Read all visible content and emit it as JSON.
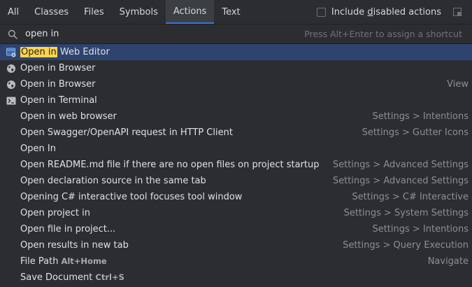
{
  "tabs": [
    {
      "label": "All",
      "active": false
    },
    {
      "label": "Classes",
      "active": false
    },
    {
      "label": "Files",
      "active": false
    },
    {
      "label": "Symbols",
      "active": false
    },
    {
      "label": "Actions",
      "active": true
    },
    {
      "label": "Text",
      "active": false
    }
  ],
  "options": {
    "include_disabled_prefix": "Include ",
    "include_disabled_mnemonic": "d",
    "include_disabled_suffix": "isabled actions",
    "include_disabled_checked": false
  },
  "search": {
    "value": "open in",
    "hint": "Press Alt+Enter to assign a shortcut"
  },
  "results": [
    {
      "pre": "",
      "hl": "Open in",
      "post": " Web Editor",
      "shortcut": "",
      "location": "",
      "icon": "web-editor-icon",
      "selected": true
    },
    {
      "pre": "",
      "hl": "",
      "post": "Open in Browser",
      "shortcut": "",
      "location": "",
      "icon": "globe-icon",
      "selected": false
    },
    {
      "pre": "",
      "hl": "",
      "post": "Open in Browser",
      "shortcut": "",
      "location": "View",
      "icon": "globe-icon",
      "selected": false
    },
    {
      "pre": "",
      "hl": "",
      "post": "Open in Terminal",
      "shortcut": "",
      "location": "",
      "icon": "terminal-icon",
      "selected": false
    },
    {
      "pre": "",
      "hl": "",
      "post": "Open in web browser",
      "shortcut": "",
      "location": "Settings > Intentions",
      "icon": "",
      "selected": false
    },
    {
      "pre": "",
      "hl": "",
      "post": "Open Swagger/OpenAPI request in HTTP Client",
      "shortcut": "",
      "location": "Settings > Gutter Icons",
      "icon": "",
      "selected": false
    },
    {
      "pre": "",
      "hl": "",
      "post": "Open In",
      "shortcut": "",
      "location": "",
      "icon": "",
      "selected": false
    },
    {
      "pre": "",
      "hl": "",
      "post": "Open README.md file if there are no open files on project startup",
      "shortcut": "",
      "location": "Settings > Advanced Settings",
      "icon": "",
      "selected": false
    },
    {
      "pre": "",
      "hl": "",
      "post": "Open declaration source in the same tab",
      "shortcut": "",
      "location": "Settings > Advanced Settings",
      "icon": "",
      "selected": false
    },
    {
      "pre": "",
      "hl": "",
      "post": "Opening C# interactive tool focuses tool window",
      "shortcut": "",
      "location": "Settings > C# Interactive",
      "icon": "",
      "selected": false
    },
    {
      "pre": "",
      "hl": "",
      "post": "Open project in",
      "shortcut": "",
      "location": "Settings > System Settings",
      "icon": "",
      "selected": false
    },
    {
      "pre": "",
      "hl": "",
      "post": "Open file in project...",
      "shortcut": "",
      "location": "Settings > Intentions",
      "icon": "",
      "selected": false
    },
    {
      "pre": "",
      "hl": "",
      "post": "Open results in new tab",
      "shortcut": "",
      "location": "Settings > Query Execution",
      "icon": "",
      "selected": false
    },
    {
      "pre": "",
      "hl": "",
      "post": "File Path",
      "shortcut": "Alt+Home",
      "location": "Navigate",
      "icon": "",
      "selected": false
    },
    {
      "pre": "",
      "hl": "",
      "post": "Save Document",
      "shortcut": "Ctrl+S",
      "location": "",
      "icon": "",
      "selected": false
    }
  ],
  "colors": {
    "background": "#2b2d30",
    "selection": "#2e436e",
    "highlight": "#ffd54f",
    "active_tab_underline": "#3574f0"
  }
}
